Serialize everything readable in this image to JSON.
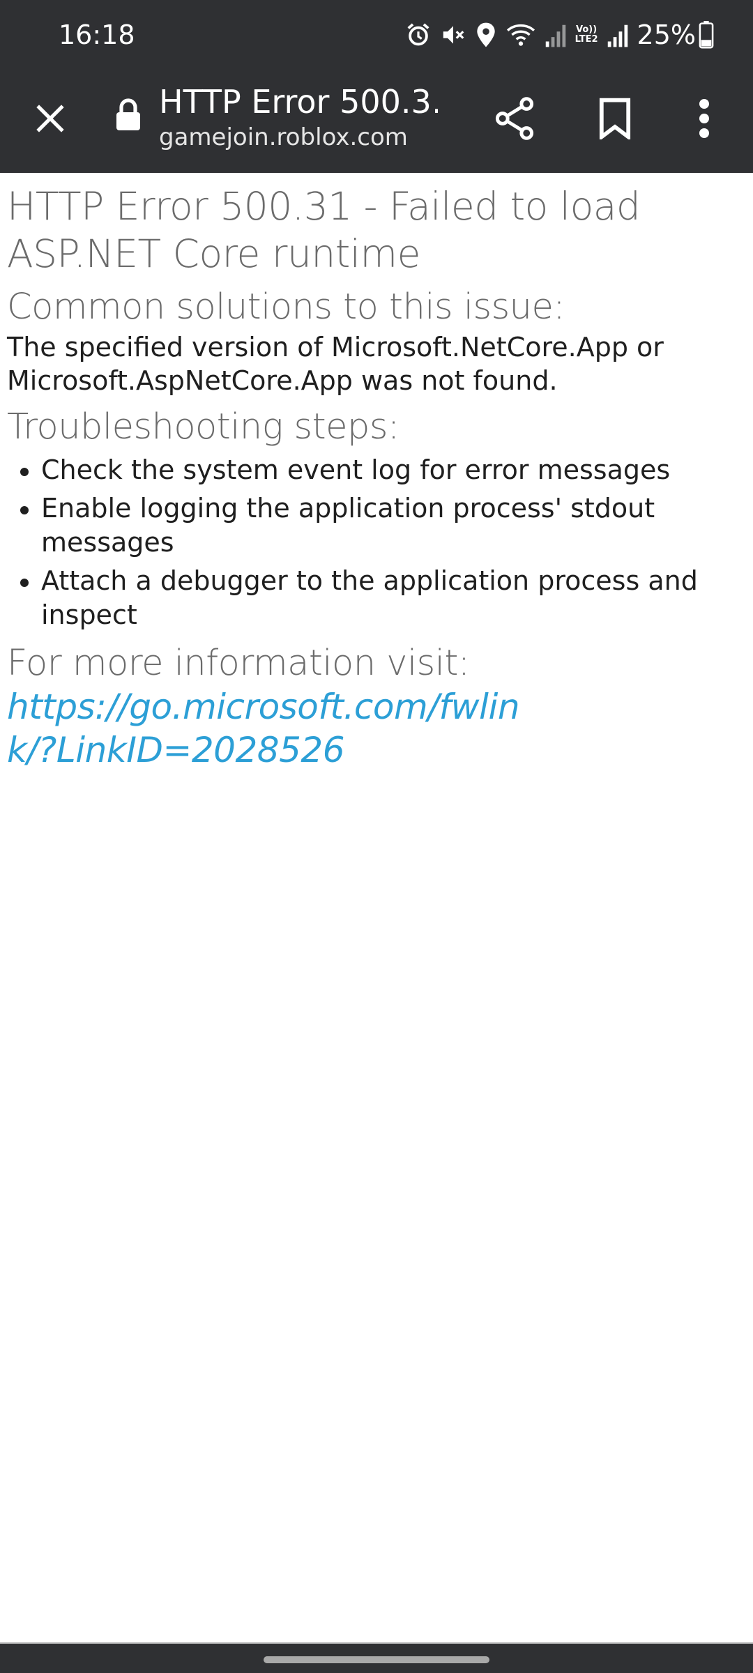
{
  "status_bar": {
    "time": "16:18",
    "volte_line1": "Vo))",
    "volte_line2": "LTE2",
    "battery_percent": "25%",
    "icons": [
      "alarm-icon",
      "mute-icon",
      "location-icon",
      "wifi-icon",
      "signal-icon",
      "volte-icon",
      "signal-icon",
      "battery-icon"
    ]
  },
  "toolbar": {
    "title": "HTTP Error 500.3…",
    "url": "gamejoin.roblox.com",
    "icons": [
      "close-icon",
      "lock-icon",
      "share-icon",
      "bookmark-icon",
      "more-vert-icon"
    ]
  },
  "page": {
    "heading": "HTTP Error 500.31 - Failed to load ASP.NET Core runtime",
    "solutions_heading": "Common solutions to this issue:",
    "solutions_text": "The specified version of Microsoft.NetCore.App or Microsoft.AspNetCore.App was not found.",
    "troubleshooting_heading": "Troubleshooting steps:",
    "steps": [
      "Check the system event log for error messages",
      "Enable logging the application process' stdout messages",
      "Attach a debugger to the application process and inspect"
    ],
    "more_info_heading": "For more information visit:",
    "link_text": "https://go.microsoft.com/fwlink/?LinkID=2028526"
  },
  "colors": {
    "bar_background": "#2f3033",
    "heading_gray": "#6b6b6b",
    "link_blue": "#2c9fd6"
  }
}
